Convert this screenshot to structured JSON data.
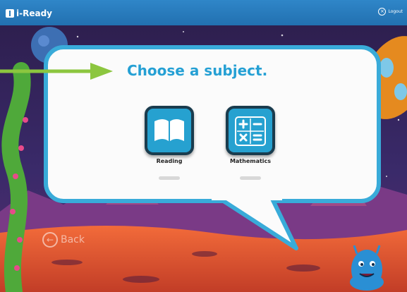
{
  "app": {
    "logo_text": "i-Ready",
    "logout_label": "Logout"
  },
  "main": {
    "heading": "Choose a subject.",
    "subjects": [
      {
        "label": "Reading",
        "icon": "book-icon"
      },
      {
        "label": "Mathematics",
        "icon": "math-operators-icon"
      }
    ],
    "back_label": "Back"
  },
  "colors": {
    "topbar": "#2a7bbd",
    "accent": "#25a0d4",
    "arrow": "#8cc63f",
    "ground": "#e85a32"
  }
}
